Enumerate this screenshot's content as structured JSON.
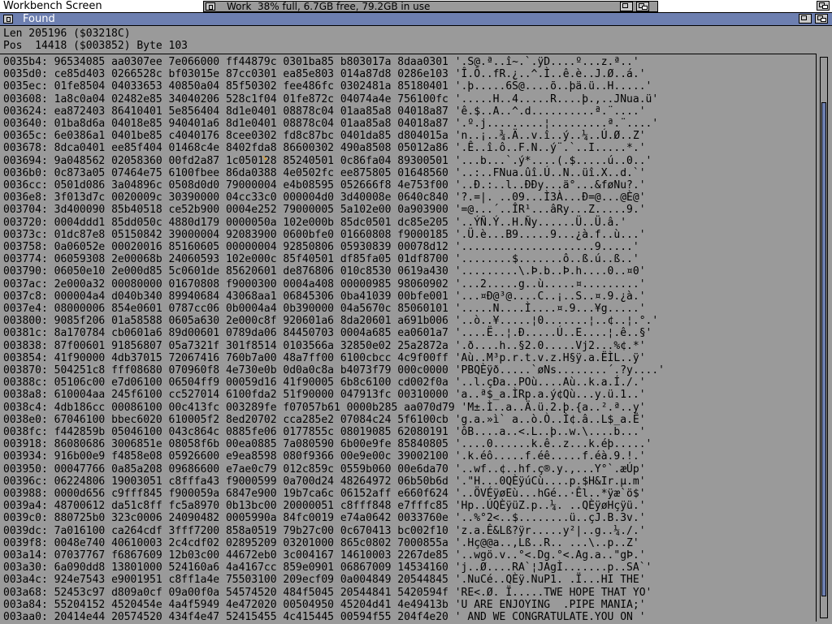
{
  "screen": {
    "title": "Workbench Screen"
  },
  "workbench_bar": {
    "text": "Work  38% full, 6.7GB free, 79.2GB in use"
  },
  "window": {
    "title": "Found"
  },
  "info": {
    "len": "Len 205196 ($03218C)",
    "pos": "Pos  14418 ($003852) Byte 103"
  },
  "colors": {
    "window_title": "#6d7fb0",
    "background": "#9a9a9a",
    "highlight": "#e8a020"
  },
  "rows": [
    {
      "addr": "0035b4:",
      "hex": "96534085 aa0307ee 7e066000 ff44879c 0301ba85 b803017a 8daa0301",
      "ascii": "'.S@.ª..î~.`.ÿD....º...z.ª..'"
    },
    {
      "addr": "0035d0:",
      "hex": "ce85d403 0266528c bf03015e 87cc0301 ea85e803 014a87d8 0286e103",
      "ascii": "'Î.Ô..fR.¿..^.Ì..ê.è..J.Ø..á.'"
    },
    {
      "addr": "0035ec:",
      "hex": "01fe8504 04033653 40850a04 85f50302 fee486fc 0302481a 85180401",
      "ascii": "'.þ.....6S@....õ..þä.ü..H.....'"
    },
    {
      "addr": "003608:",
      "hex": "1a8c0a04 02482e85 34040206 528c1f04 01fe872c 04074a4e 756100fc",
      "ascii": "'.....H..4.....R....þ.,..JNua.ü'"
    },
    {
      "addr": "003624:",
      "hex": "ea872403 86410401 5e856404 8d1e0401 08878c04 01aa85a8 04018a87",
      "ascii": "'ê.$..A..^.d..........ª.¨....'"
    },
    {
      "addr": "003640:",
      "hex": "01ba8d6a 04018e85 940401a6 8d1e0401 08878c04 01aa85a8 04018a87",
      "ascii": "'.º.j.........¦.........ª.¨....'"
    },
    {
      "addr": "00365c:",
      "hex": "6e0386a1 0401be85 c4040176 8cee0302 fd8c87bc 0401da85 d804015a",
      "ascii": "'n..¡..¾.Ä..v.î..ý..¼..Ú.Ø..Z'"
    },
    {
      "addr": "003678:",
      "hex": "8dca0401 ee85f404 01468c4e 8402fda8 86600302 490a8508 05012a86",
      "ascii": "'.Ê..î.ô..F.N..ý¨.`..I.....*.'"
    },
    {
      "addr": "003694:",
      "hex": "9a048562 02058360 00fd2a87 1c050128 85240501 0c86fa04 89300501",
      "ascii": "'...b...`.ý*....(.$.....ú..0..'"
    },
    {
      "addr": "0036b0:",
      "hex": "0c873a05 07464e75 6100fbee 86da0388 4e0502fc ee875805 01648560",
      "ascii": "'..:..FNua.ûî.Ú..N..üî.X..d.`'"
    },
    {
      "addr": "0036cc:",
      "hex": "0501d086 3a04896c 0508d0d0 79000004 e4b08595 052666f8 4e753f00",
      "ascii": "'..Ð.:..l..ÐÐy...ä°...&føNu?.'"
    },
    {
      "addr": "0036e8:",
      "hex": "3f013d7c 0020009c 30390000 04cc33c0 000004d0 3d40008e 0640c840",
      "ascii": "'?.=|. ..09...Ì3À...Ð=@...@È@'"
    },
    {
      "addr": "003704:",
      "hex": "3d400090 85b40518 ce52b900 0004e252 79000005 5a102e00 0a903900",
      "ascii": "'=@...´..ÎR¹...âRy...Z.....9.'"
    },
    {
      "addr": "003720:",
      "hex": "0004ddd1 85dd050c 4880d179 0000050a 102e000b 85dc0501 dc85e205",
      "ascii": "'..ÝÑ.Ý..H.Ñy......Ü..Ü.â.'"
    },
    {
      "addr": "00373c:",
      "hex": "01dc87e8 05150842 39000004 92083900 0600bfe0 01660808 f9000185",
      "ascii": "'.Ü.è...B9.....9...¿à.f..ù...'"
    },
    {
      "addr": "003758:",
      "hex": "0a06052e 00020016 85160605 00000004 92850806 05930839 00078d12",
      "ascii": "'.....................9.....'"
    },
    {
      "addr": "003774:",
      "hex": "06059308 2e00068b 24060593 102e000c 85f40501 df85fa05 01df8700",
      "ascii": "'........$.......ô..ß.ú..ß..'"
    },
    {
      "addr": "003790:",
      "hex": "06050e10 2e000d85 5c0601de 85620601 de876806 010c8530 0619a430",
      "ascii": "'.........\\.Þ.b..Þ.h....0..¤0'"
    },
    {
      "addr": "0037ac:",
      "hex": "2e000a32 00080000 01670808 f9000300 0004a408 00000985 98060902",
      "ascii": "'...2.....g..ù.....¤.........'"
    },
    {
      "addr": "0037c8:",
      "hex": "000004a4 d040b340 89940684 43068aa1 06845306 0ba41039 00bfe001",
      "ascii": "'...¤Ð@³@....C..¡..S..¤.9.¿à.'"
    },
    {
      "addr": "0037e4:",
      "hex": "08000006 854e0601 0787cc06 0b0004a4 0b390000 04a5670c 85060101",
      "ascii": "'.....N....Ì....¤.9...¥g.....'"
    },
    {
      "addr": "003800:",
      "hex": "9085f206 01a58588 0605a630 2e000c8f 920601a6 8da20601 a691b006",
      "ascii": "'..ò..¥.....¦0.......¦..¢..¦.°.'"
    },
    {
      "addr": "00381c:",
      "hex": "8a170784 cb0601a6 89d00601 0789da06 84450703 0004a685 ea0601a7",
      "ascii": "'....Ë..¦.Ð.....Ú..E....¦.ê..§'"
    },
    {
      "addr": "003838:",
      "hex": "87f00601 91856807 05a7321f 301f8514 0103566a 32850e02 25a2872a",
      "ascii": "'.ð....h..§2.0.....Vj2...%¢.*'"
    },
    {
      "addr": "003854:",
      "hex": "41f90000 4db37015 72067416 760b7a00 48a7ff00 6100cbcc 4c9f00ff",
      "ascii": "'Aù..M³p.r.t.v.z.H§ÿ.a.ËÌL..ÿ'"
    },
    {
      "addr": "003870:",
      "hex": "504251c8 fff08680 070960f8 4e730e0b 0d0a0c8a b4073f79 000c0000",
      "ascii": "'PBQÈÿð.....`øNs........´.?y....'"
    },
    {
      "addr": "00388c:",
      "hex": "05106c00 e7d06100 06504ff9 00059d16 41f90005 6b8c6100 cd002f0a",
      "ascii": "'..l.çÐa..POù....Aù..k.a.Í./.'"
    },
    {
      "addr": "0038a8:",
      "hex": "610004aa 245f6100 cc527014 6100fda2 51f90000 047913fc 00310000",
      "ascii": "'a..ª$_a.ÌRp.a.ý¢Qù...y.ü.1..'"
    },
    {
      "addr": "0038c4:",
      "hex": "4db186cc 00086100 00c413fc 003289fe f07057b61 0000b285 aa070d79",
      "ascii": "'M±.Ì..a..Ä.ü.2.þ.{a..².ª..y'"
    },
    {
      "addr": "0038e0:",
      "hex": "67046100 bbec6020 610005f2 8ed20702 cca285e2 07084c24 5f6100cb",
      "ascii": "'g.a.»ì` a..ò.Ò..Ì¢.â..L$_a.Ë'"
    },
    {
      "addr": "0038fc:",
      "hex": "f442859b 05046100 043c864c 0885fe06 0177855c 08019085 62080191",
      "ascii": "'ôB....a..<.L..þ..w.\\....b...'"
    },
    {
      "addr": "003918:",
      "hex": "86080686 3006851e 08058f6b 00ea0885 7a080590 6b00e9fe 85840805",
      "ascii": "'....0......k.ê..z...k.éþ.....'"
    },
    {
      "addr": "003934:",
      "hex": "916b00e9 f4858e08 05926600 e9ea8598 080f9366 00e9e00c 39002100",
      "ascii": "'.k.éô.....f.éê.....f.éà.9.!.'"
    },
    {
      "addr": "003950:",
      "hex": "00047766 0a85a208 09686600 e7ae0c79 012c859c 0559b060 00e6da70",
      "ascii": "'..wf..¢..hf.ç®.y.,...Y°`.æÚp'"
    },
    {
      "addr": "00396c:",
      "hex": "06224806 19003051 c8fffa43 f9000599 0a700d24 48264972 06b50b6d",
      "ascii": "'.\"H...0QÈÿúCù....p.$H&Ir.µ.m'"
    },
    {
      "addr": "003988:",
      "hex": "0000d656 c9fff845 f900059a 6847e900 19b7ca6c 06152aff e660f624",
      "ascii": "'..ÖVÉÿøEù...hGé..·Êl..*ÿæ`ö$'"
    },
    {
      "addr": "0039a4:",
      "hex": "48700612 da51c8ff fc5a8970 0b13bc00 20000051 c8fff848 e7fffc85",
      "ascii": "'Hp..ÚQÈÿüZ.p..¼. ..QÈÿøHçÿü.'"
    },
    {
      "addr": "0039c0:",
      "hex": "880725b0 323c0006 24090482 0005990a 84fc0019 e74a0642 0033760e",
      "ascii": "'..%°2<..$........ü..çJ.B.3v.'"
    },
    {
      "addr": "0039dc:",
      "hex": "7a016100 ca264cdf 3fff7200 858a0519 79b27c00 0c670413 bc002f10",
      "ascii": "'z.a.Ê&Lß?ÿr.....y²|..g..¼./.'"
    },
    {
      "addr": "0039f8:",
      "hex": "0048e740 40610003 2c4cdf02 02895209 03201000 865c0802 7000855a",
      "ascii": "'.Hç@@a..,Lß..R.. ...\\..p..Z'"
    },
    {
      "addr": "003a14:",
      "hex": "07037767 f6867609 12b03c00 44672eb0 3c004167 14610003 2267de85",
      "ascii": "'..wgö.v..°<.Dg.°<.Ag.a..\"gÞ.'"
    },
    {
      "addr": "003a30:",
      "hex": "6a090dd8 13801000 524160a6 4a4167cc 859e0901 06867009 14534160",
      "ascii": "'j..Ø....RA`¦JAgÌ.......p..SA`'"
    },
    {
      "addr": "003a4c:",
      "hex": "924e7543 e9001951 c8ff1a4e 75503100 209ecf09 0a004849 20544845",
      "ascii": "'.NuCé..QÈÿ.NuP1. .Ï...HI THE'"
    },
    {
      "addr": "003a68:",
      "hex": "52453c97 d809a0cf 09a00f0a 54574520 484f5045 20544841 5420594f",
      "ascii": "'RE<.Ø. Ï.....TWE HOPE THAT YO'"
    },
    {
      "addr": "003a84:",
      "hex": "55204152 4520454e 4a4f5949 4e472020 00504950 45204d41 4e49413b",
      "ascii": "'U ARE ENJOYING  .PIPE MANIA;'"
    },
    {
      "addr": "003aa0:",
      "hex": "20414e44 20574520 434f4e47 52415455 4c415445 00594f55 204f4e20",
      "ascii": "' AND WE CONGRATULATE.YOU ON '"
    }
  ],
  "scrollbar": {
    "position": 0.08,
    "visible_fraction": 0.9
  }
}
